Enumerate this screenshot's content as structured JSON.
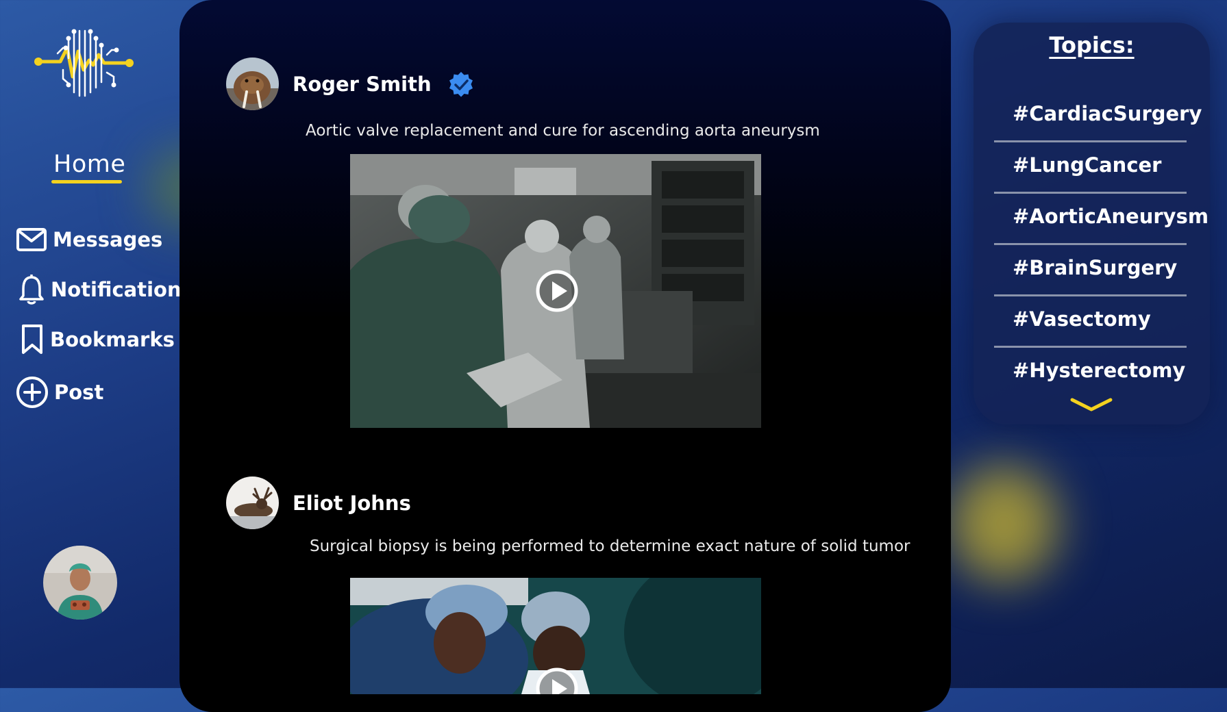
{
  "sidebar": {
    "home_label": "Home",
    "items": [
      {
        "label": "Messages",
        "icon": "envelope-icon"
      },
      {
        "label": "Notifications",
        "icon": "bell-icon"
      },
      {
        "label": "Bookmarks",
        "icon": "bookmark-icon"
      },
      {
        "label": "Post",
        "icon": "plus-circle-icon"
      }
    ]
  },
  "feed": {
    "posts": [
      {
        "author": "Roger Smith",
        "verified": true,
        "caption": "Aortic valve replacement and cure for ascending aorta aneurysm",
        "media_type": "video"
      },
      {
        "author": "Eliot Johns",
        "verified": false,
        "caption": "Surgical biopsy is being performed to determine exact nature of solid tumor",
        "media_type": "video"
      }
    ]
  },
  "topics": {
    "title": "Topics:",
    "items": [
      "#CardiacSurgery",
      "#LungCancer",
      "#AorticAneurysm",
      "#BrainSurgery",
      "#Vasectomy",
      "#Hysterectomy"
    ],
    "more_icon": "chevron-down-icon"
  },
  "colors": {
    "accent": "#f4d21f",
    "verified_badge": "#3b8cf0",
    "background_blue": "#1d3d86",
    "feed_background": "#000000"
  }
}
